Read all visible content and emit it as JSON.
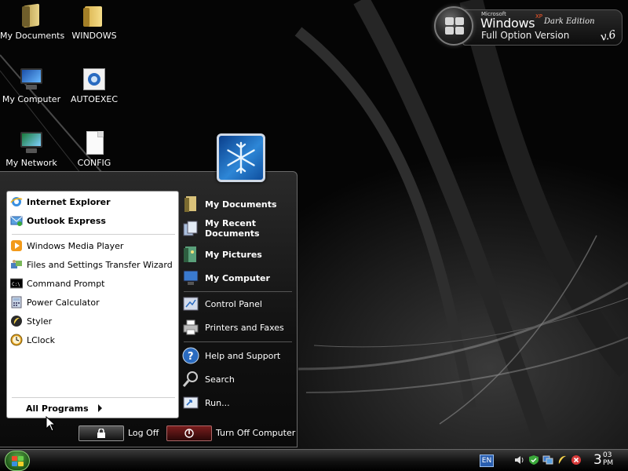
{
  "colors": {
    "wallpaper": "#050505",
    "start_menu_bg": "#1a1a1a",
    "left_pane_bg": "#ffffff",
    "start_button": "#2f7a25",
    "turn_off_button": "#5a1414"
  },
  "branding": {
    "microsoft": "Microsoft",
    "windows": "Windows",
    "xp": "XP",
    "dark_edition": "Dark Edition",
    "full_option": "Full Option Version",
    "version": "v.6"
  },
  "desktop_icons": [
    {
      "label": "My Documents",
      "icon": "my-documents-icon"
    },
    {
      "label": "WINDOWS",
      "icon": "folder-icon"
    },
    {
      "label": "My Computer",
      "icon": "my-computer-icon"
    },
    {
      "label": "AUTOEXEC",
      "icon": "settings-file-icon"
    },
    {
      "label": "My Network",
      "icon": "network-icon"
    },
    {
      "label": "CONFIG",
      "icon": "text-file-icon"
    }
  ],
  "start_menu": {
    "pinned": [
      {
        "label": "Internet Explorer",
        "icon": "internet-explorer-icon"
      },
      {
        "label": "Outlook Express",
        "icon": "outlook-express-icon"
      }
    ],
    "recent": [
      {
        "label": "Windows Media Player",
        "icon": "media-player-icon"
      },
      {
        "label": "Files and Settings Transfer Wizard",
        "icon": "transfer-wizard-icon"
      },
      {
        "label": "Command Prompt",
        "icon": "command-prompt-icon"
      },
      {
        "label": "Power Calculator",
        "icon": "calculator-icon"
      },
      {
        "label": "Styler",
        "icon": "styler-icon"
      },
      {
        "label": "LClock",
        "icon": "clock-icon"
      }
    ],
    "all_programs": "All Programs",
    "places": [
      {
        "label": "My Documents",
        "icon": "my-documents-icon"
      },
      {
        "label": "My Recent Documents",
        "icon": "recent-documents-icon"
      },
      {
        "label": "My Pictures",
        "icon": "my-pictures-icon"
      },
      {
        "label": "My Computer",
        "icon": "my-computer-icon"
      }
    ],
    "system": [
      {
        "label": "Control Panel",
        "icon": "control-panel-icon"
      },
      {
        "label": "Printers and Faxes",
        "icon": "printer-icon"
      }
    ],
    "help": [
      {
        "label": "Help and Support",
        "icon": "help-icon"
      },
      {
        "label": "Search",
        "icon": "search-icon"
      },
      {
        "label": "Run...",
        "icon": "run-icon"
      }
    ],
    "log_off": "Log Off",
    "turn_off": "Turn Off Computer"
  },
  "taskbar": {
    "language": "EN",
    "tray_icons": [
      "volume-icon",
      "security-shield-icon",
      "network-tray-icon",
      "styler-tray-icon",
      "close-tray-icon"
    ],
    "clock_hour": "3",
    "clock_minute": "03",
    "clock_ampm": "PM"
  }
}
